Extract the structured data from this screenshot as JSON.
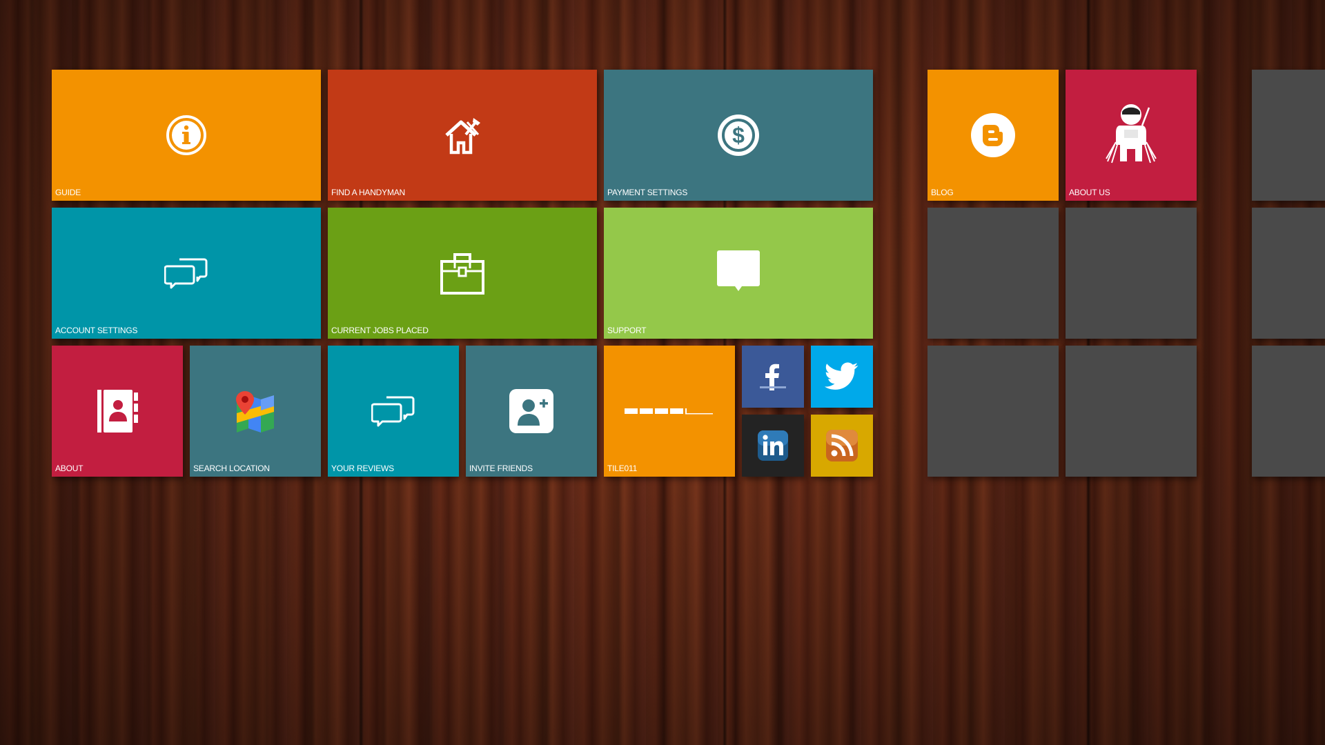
{
  "tiles": {
    "guide": {
      "label": "GUIDE",
      "color": "#f39200",
      "icon": "info-icon"
    },
    "find_handyman": {
      "label": "FIND A HANDYMAN",
      "color": "#c23a16",
      "icon": "house-tools-icon"
    },
    "payment_settings": {
      "label": "PAYMENT SETTINGS",
      "color": "#3c7580",
      "icon": "dollar-icon"
    },
    "account_settings": {
      "label": "ACCOUNT SETTINGS",
      "color": "#0095a8",
      "icon": "chat-bubbles-icon"
    },
    "current_jobs": {
      "label": "CURRENT JOBS PLACED",
      "color": "#6ba015",
      "icon": "briefcase-icon"
    },
    "support": {
      "label": "SUPPORT",
      "color": "#94c84a",
      "icon": "speech-bubble-icon"
    },
    "about": {
      "label": "ABOUT",
      "color": "#c21e40",
      "icon": "contacts-book-icon"
    },
    "search_location": {
      "label": "SEARCH LOCATION",
      "color": "#3c7580",
      "icon": "map-pin-icon"
    },
    "your_reviews": {
      "label": "YOUR REVIEWS",
      "color": "#0095a8",
      "icon": "chat-bubbles-icon"
    },
    "invite_friends": {
      "label": "INVITE FRIENDS",
      "color": "#3c7580",
      "icon": "add-user-icon"
    },
    "tile011": {
      "label": "TILE011",
      "color": "#f39200",
      "icon": "progress-dashes-icon"
    },
    "facebook": {
      "label": "",
      "color": "#3b5998",
      "icon": "facebook-icon"
    },
    "twitter": {
      "label": "",
      "color": "#00a9ea",
      "icon": "twitter-icon"
    },
    "linkedin": {
      "label": "",
      "color": "#232323",
      "icon": "linkedin-icon"
    },
    "rss": {
      "label": "",
      "color": "#d8a800",
      "icon": "rss-icon"
    },
    "blog": {
      "label": "BLOG",
      "color": "#f39200",
      "icon": "blogger-icon"
    },
    "about_us": {
      "label": "ABOUT US",
      "color": "#c21e40",
      "icon": "astronaut-icon"
    }
  },
  "empty_tile_color": "#4a4a4a"
}
